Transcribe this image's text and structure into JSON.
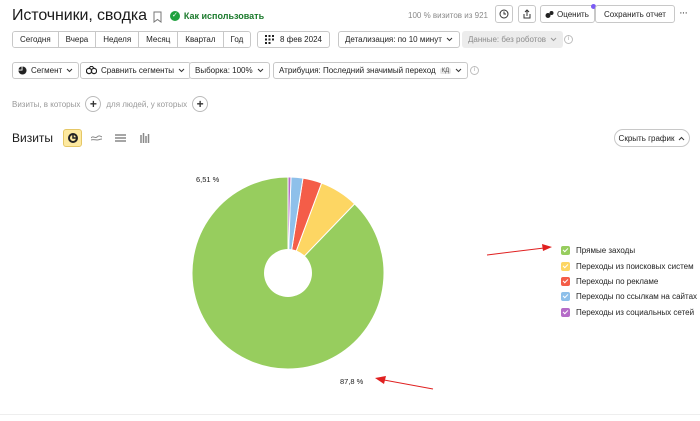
{
  "header": {
    "title": "Источники, сводка",
    "howto_label": "Как использовать",
    "visits_total": "100 % визитов из 921",
    "rate_label": "Оценить",
    "save_report_label": "Сохранить отчет",
    "more_label": "···"
  },
  "toolbar": {
    "periods": [
      "Сегодня",
      "Вчера",
      "Неделя",
      "Месяц",
      "Квартал",
      "Год"
    ],
    "date_label": "8 фев 2024",
    "detail_label": "Детализация: по 10 минут",
    "data_label": "Данные: без роботов"
  },
  "filters": {
    "segment_label": "Сегмент",
    "compare_label": "Сравнить сегменты",
    "sample_label": "Выборка: 100%",
    "attribution_label": "Атрибуция: Последний значимый переход",
    "attribution_tag": "КД"
  },
  "conditions": {
    "visits_label": "Визиты, в которых",
    "people_label": "для людей, у которых"
  },
  "chart_header": {
    "title": "Визиты",
    "hide_chart_label": "Скрыть график"
  },
  "chart_data": {
    "type": "pie",
    "donut": true,
    "labels_shown": [
      "87,8 %",
      "6,51 %"
    ],
    "series": [
      {
        "name": "Прямые заходы",
        "value": 87.8,
        "color": "#97cd5e"
      },
      {
        "name": "Переходы из поисковых систем",
        "value": 6.51,
        "color": "#fdd663"
      },
      {
        "name": "Переходы по рекламе",
        "value": 3.2,
        "color": "#f45d48"
      },
      {
        "name": "Переходы по ссылкам на сайтах",
        "value": 2.0,
        "color": "#8ec0ea"
      },
      {
        "name": "Переходы из социальных сетей",
        "value": 0.49,
        "color": "#b56cc8"
      }
    ]
  },
  "annotations": {
    "arrow_color": "#e02020"
  }
}
